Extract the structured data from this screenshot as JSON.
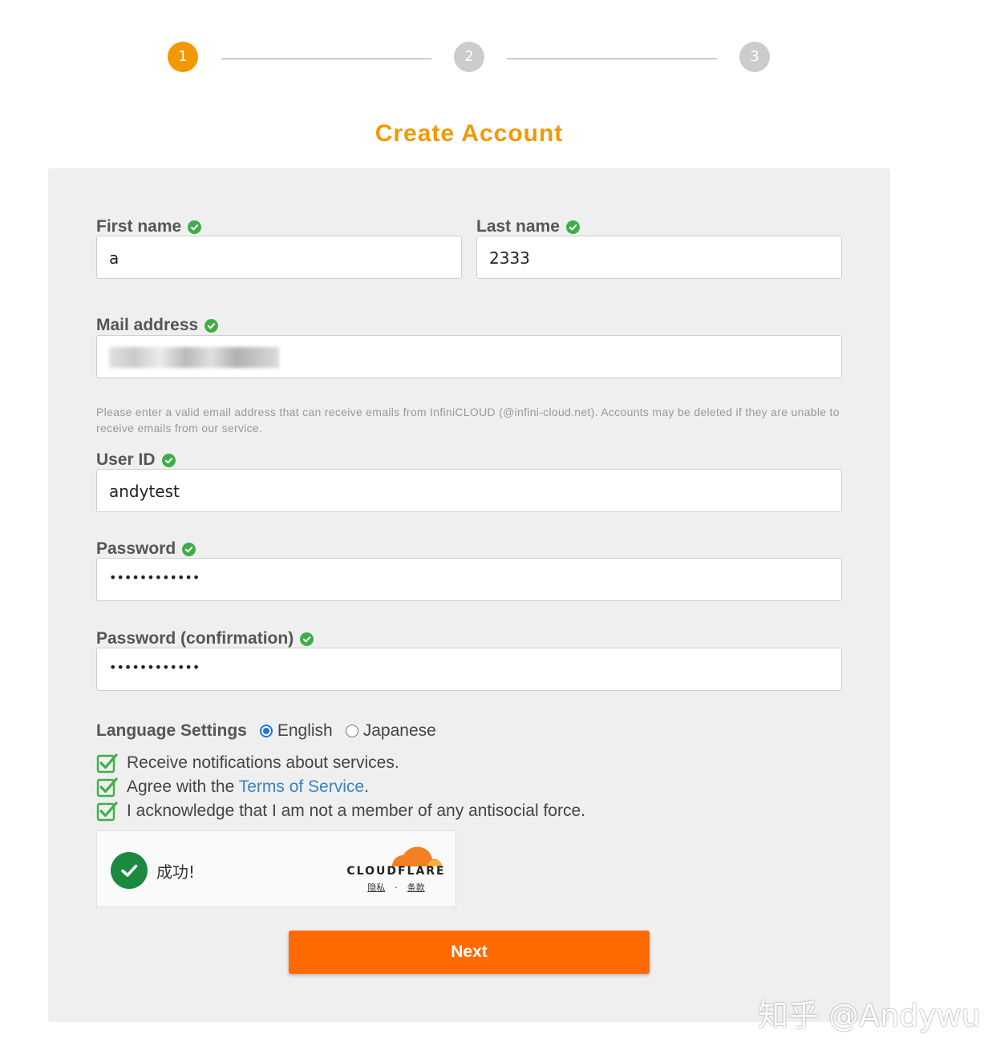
{
  "stepper": {
    "steps": [
      {
        "number": "1",
        "state": "active"
      },
      {
        "number": "2",
        "state": "inactive"
      },
      {
        "number": "3",
        "state": "inactive"
      }
    ]
  },
  "page_title": "Create Account",
  "form": {
    "first_name": {
      "label": "First name",
      "value": "a"
    },
    "last_name": {
      "label": "Last name",
      "value": "2333"
    },
    "mail": {
      "label": "Mail address",
      "value": ""
    },
    "mail_hint": "Please enter a valid email address that can receive emails from InfiniCLOUD (@infini-cloud.net). Accounts may be deleted if they are unable to receive emails from our service.",
    "user_id": {
      "label": "User ID",
      "value": "andytest"
    },
    "password": {
      "label": "Password",
      "value": "••••••••••••"
    },
    "password_confirm": {
      "label": "Password (confirmation)",
      "value": "••••••••••••"
    },
    "language": {
      "label": "Language Settings",
      "options": [
        "English",
        "Japanese"
      ],
      "selected": "English"
    },
    "checks": [
      {
        "text": "Receive notifications about services.",
        "checked": true
      },
      {
        "text_before": "Agree with the ",
        "link": "Terms of Service",
        "text_after": ".",
        "checked": true
      },
      {
        "text": "I acknowledge that I am not a member of any antisocial force.",
        "checked": true
      }
    ],
    "next_label": "Next"
  },
  "captcha": {
    "status": "成功!",
    "brand": "CLOUDFLARE",
    "privacy": "隐私",
    "separator": "·",
    "terms": "条款"
  },
  "watermark": "知乎 @Andywu",
  "colors": {
    "accent": "#f39800",
    "button": "#ff6a00",
    "ok": "#3fae49",
    "link": "#3a82c4",
    "panel": "#efefef"
  }
}
